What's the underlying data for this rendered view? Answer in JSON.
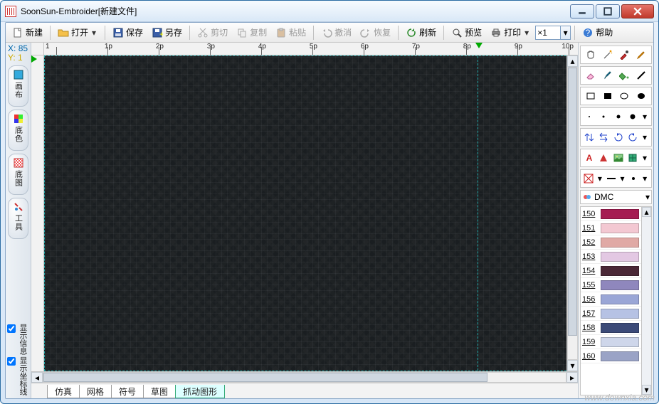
{
  "window": {
    "title": "SoonSun-Embroider[新建文件]"
  },
  "toolbar": {
    "new": "新建",
    "open": "打开",
    "save": "保存",
    "saveas": "另存",
    "cut": "剪切",
    "copy": "复制",
    "paste": "粘贴",
    "undo": "撤消",
    "redo": "恢复",
    "refresh": "刷新",
    "preview": "预览",
    "print": "打印",
    "zoom_value": "×1",
    "help": "帮助"
  },
  "coord": {
    "x_label": "X:",
    "x_val": "85",
    "y_label": "Y:",
    "y_val": "1"
  },
  "left_tabs": {
    "canvas": "画布",
    "basecolor": "底色",
    "baseimg": "底图",
    "tools": "工具"
  },
  "left_bottom": {
    "show_info": "显示信息",
    "show_coord": "显示坐标线"
  },
  "ruler_ticks": [
    "1",
    "1p",
    "2p",
    "3p",
    "4p",
    "5p",
    "6p",
    "7p",
    "8p",
    "9p",
    "10p"
  ],
  "bottom_tabs": [
    "仿真",
    "网格",
    "符号",
    "草图",
    "抓动图形"
  ],
  "bottom_tabs_active": 4,
  "palette": {
    "label": "DMC",
    "items": [
      {
        "num": "150",
        "color": "#a51c52"
      },
      {
        "num": "151",
        "color": "#f3c8d2"
      },
      {
        "num": "152",
        "color": "#e0a9a5"
      },
      {
        "num": "153",
        "color": "#e3c8e3"
      },
      {
        "num": "154",
        "color": "#4a2736"
      },
      {
        "num": "155",
        "color": "#8f87bd"
      },
      {
        "num": "156",
        "color": "#9aa6d6"
      },
      {
        "num": "157",
        "color": "#b6c2e4"
      },
      {
        "num": "158",
        "color": "#3b4a78"
      },
      {
        "num": "159",
        "color": "#ced6ea"
      },
      {
        "num": "160",
        "color": "#9aa3c6"
      }
    ]
  },
  "watermark": "www.downxia.com"
}
